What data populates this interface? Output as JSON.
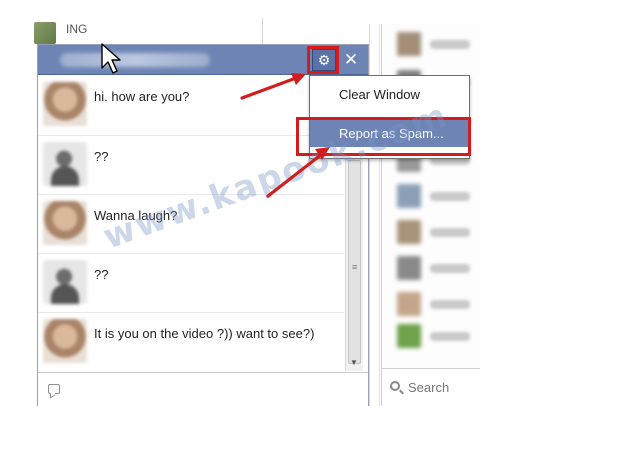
{
  "background_row": {
    "text": "ING"
  },
  "chat": {
    "messages": [
      {
        "avatar": "female-avatar",
        "text": "hi. how are you?"
      },
      {
        "avatar": "male-avatar",
        "text": "??"
      },
      {
        "avatar": "female-avatar",
        "text": "Wanna laugh?"
      },
      {
        "avatar": "male-avatar",
        "text": "??"
      },
      {
        "avatar": "female-avatar",
        "text": "It is you on the video ?)) want to see?)"
      }
    ],
    "gear_icon": "gear-icon",
    "close_icon": "close-icon",
    "footer_icon": "chat-bubble-icon"
  },
  "menu": {
    "clear_window": "Clear Window",
    "report_spam": "Report as Spam..."
  },
  "sidebar": {
    "search_label": "Search"
  },
  "watermark": "www.kapook.com",
  "colors": {
    "header_blue": "#6d84b4",
    "highlight_blue": "#6d84b4",
    "callout_red": "#d11d1d"
  }
}
